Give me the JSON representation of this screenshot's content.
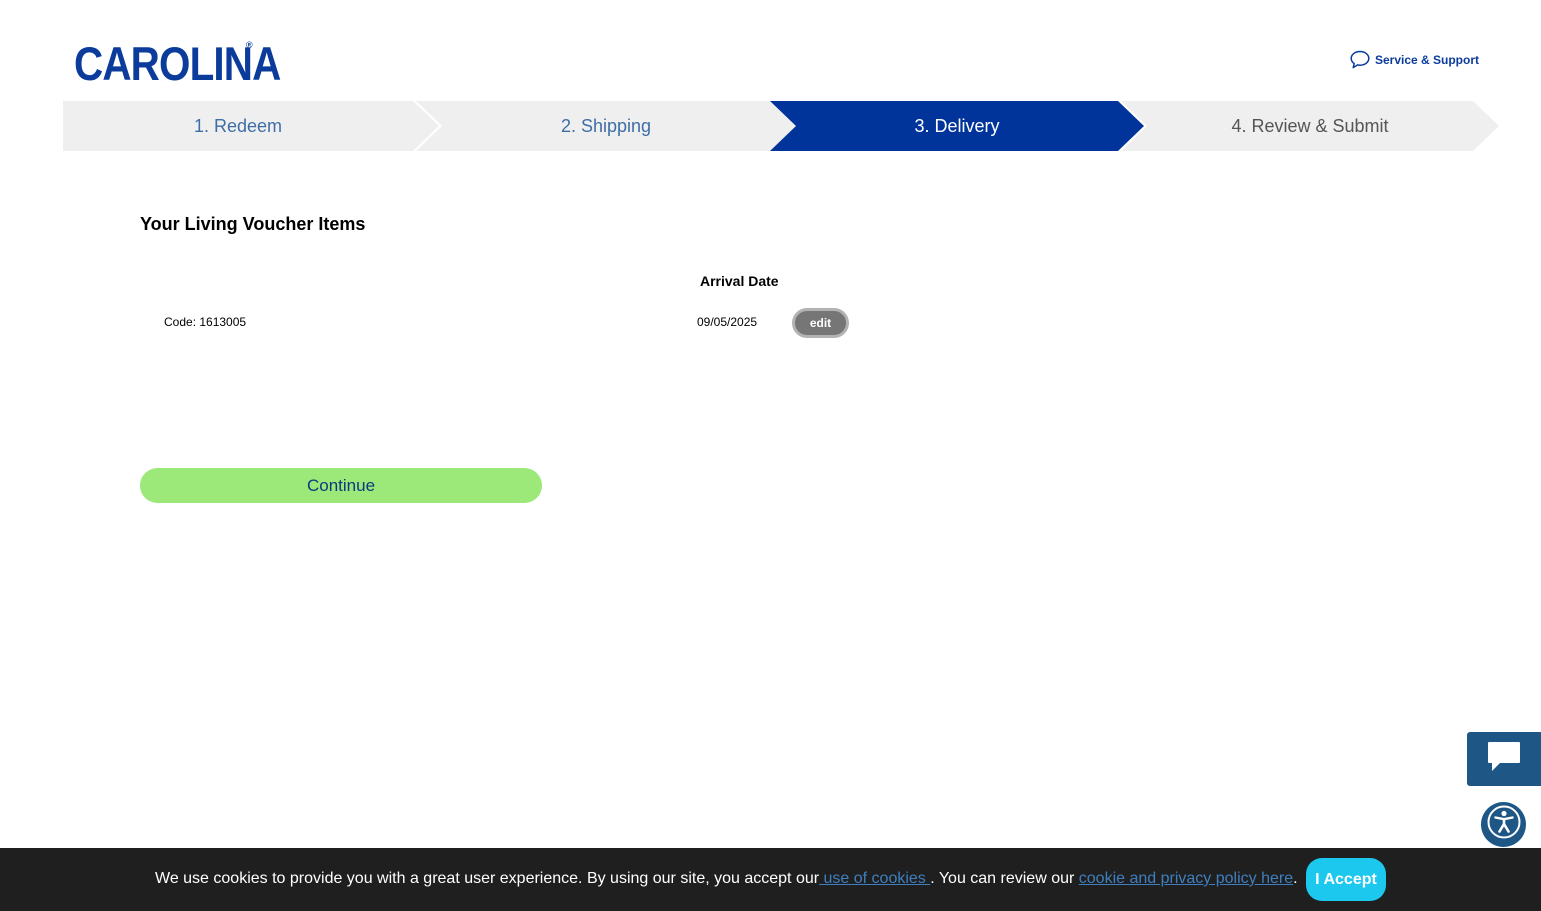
{
  "header": {
    "logo_text": "CAROLINA",
    "logo_mark": "®",
    "support_label": "Service & Support",
    "support_icon": "speech-bubble-icon"
  },
  "stepper": {
    "steps": [
      {
        "label": "1. Redeem",
        "state": "completed"
      },
      {
        "label": "2. Shipping",
        "state": "completed"
      },
      {
        "label": "3. Delivery",
        "state": "active"
      },
      {
        "label": "4. Review & Submit",
        "state": "upcoming"
      }
    ],
    "active_color": "#00349b",
    "inactive_color": "#efefef"
  },
  "main": {
    "section_title": "Your Living Voucher Items",
    "arrival_header": "Arrival Date",
    "item": {
      "code": "Code: 1613005",
      "arrival_date": "09/05/2025",
      "edit_label": "edit"
    },
    "continue_label": "Continue",
    "continue_color": "#9ce97a"
  },
  "widgets": {
    "chat_icon": "chat-icon",
    "accessibility_icon": "accessibility-icon"
  },
  "cookie_bar": {
    "text_before": "We use cookies to provide you with a great user experience. By using our site, you accept our",
    "link_cookies": " use of cookies ",
    "text_middle": ". You can review our ",
    "link_policy": "cookie and privacy policy here",
    "text_after": ".",
    "accept_label": "I Accept",
    "accept_color": "#1cc8ee"
  }
}
